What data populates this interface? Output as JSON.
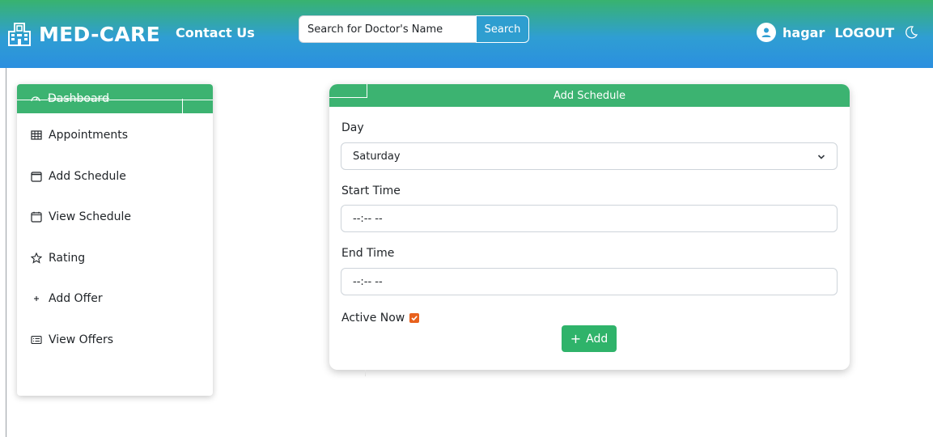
{
  "header": {
    "brand": "MED-CARE",
    "contact_label": "Contact Us",
    "search_placeholder": "Search for Doctor's Name",
    "search_button": "Search",
    "username": "hagar",
    "logout_label": "LOGOUT"
  },
  "sidebar": {
    "items": [
      {
        "label": "Dashboard",
        "icon": "speedometer-icon"
      },
      {
        "label": "Appointments",
        "icon": "table-icon"
      },
      {
        "label": "Add Schedule",
        "icon": "calendar-icon"
      },
      {
        "label": "View Schedule",
        "icon": "calendar-icon"
      },
      {
        "label": "Rating",
        "icon": "star-icon"
      },
      {
        "label": "Add Offer",
        "icon": "plus-icon"
      },
      {
        "label": "View Offers",
        "icon": "card-list-icon"
      }
    ]
  },
  "form": {
    "title": "Add Schedule",
    "day_label": "Day",
    "day_value": "Saturday",
    "start_label": "Start Time",
    "start_value": "--:-- --",
    "end_label": "End Time",
    "end_value": "--:-- --",
    "active_label": "Active Now",
    "active_checked": true,
    "add_button": "Add"
  },
  "colors": {
    "header_green": "#38b36f",
    "header_blue": "#2b8fdf",
    "accent_green": "#3cb371",
    "checkbox_orange": "#e8611d"
  }
}
